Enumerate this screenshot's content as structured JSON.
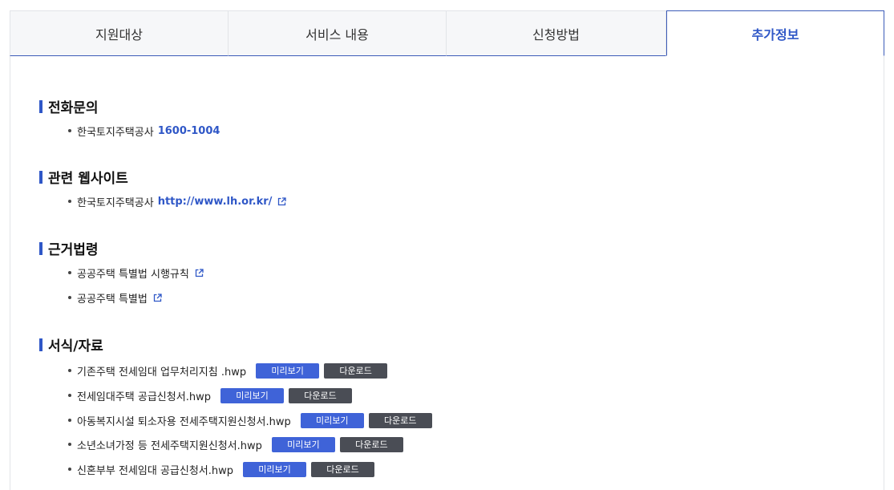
{
  "tabs": [
    {
      "label": "지원대상"
    },
    {
      "label": "서비스 내용"
    },
    {
      "label": "신청방법"
    },
    {
      "label": "추가정보"
    }
  ],
  "sections": {
    "phone": {
      "title": "전화문의",
      "items": [
        {
          "text": "한국토지주택공사",
          "value": "1600-1004"
        }
      ]
    },
    "sites": {
      "title": "관련 웹사이트",
      "items": [
        {
          "text": "한국토지주택공사",
          "value": "http://www.lh.or.kr/",
          "icon": "external-link-icon"
        }
      ]
    },
    "laws": {
      "title": "근거법령",
      "items": [
        {
          "text": "공공주택 특별법 시행규칙",
          "icon": "external-link-icon"
        },
        {
          "text": "공공주택 특별법",
          "icon": "external-link-icon"
        }
      ]
    },
    "forms": {
      "title": "서식/자료",
      "preview_label": "미리보기",
      "download_label": "다운로드",
      "items": [
        {
          "text": "기존주택 전세임대 업무처리지침 .hwp"
        },
        {
          "text": "전세임대주택 공급신청서.hwp"
        },
        {
          "text": "아동복지시설 퇴소자용 전세주택지원신청서.hwp"
        },
        {
          "text": "소년소녀가정 등 전세주택지원신청서.hwp"
        },
        {
          "text": "신혼부부 전세임대 공급신청서.hwp"
        }
      ]
    }
  },
  "colors": {
    "accent": "#2f57c7",
    "preview_button": "#3f63d8",
    "download_button": "#4a4d55"
  }
}
